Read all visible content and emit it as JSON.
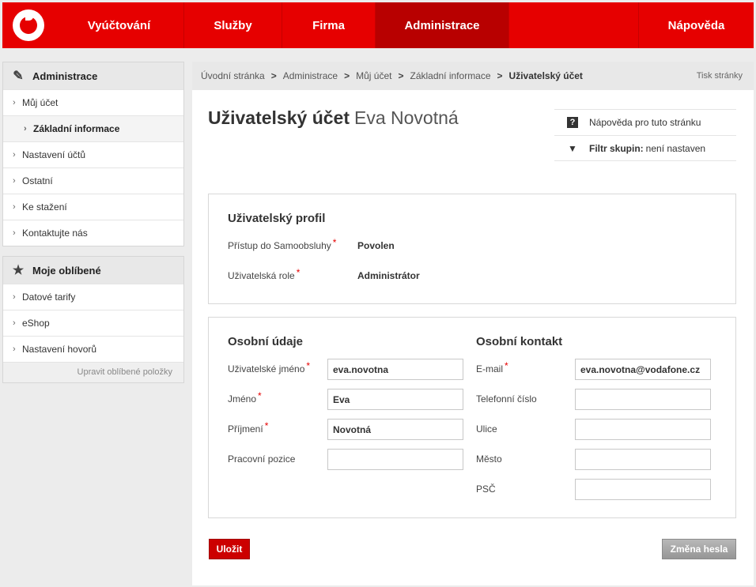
{
  "nav": {
    "items": [
      "Vyúčtování",
      "Služby",
      "Firma",
      "Administrace"
    ],
    "help": "Nápověda"
  },
  "sidebar": {
    "admin": {
      "title": "Administrace",
      "items": [
        "Můj účet",
        "Základní informace",
        "Nastavení účtů",
        "Ostatní",
        "Ke stažení",
        "Kontaktujte nás"
      ]
    },
    "favorites": {
      "title": "Moje oblíbené",
      "items": [
        "Datové tarify",
        "eShop",
        "Nastavení hovorů"
      ],
      "edit": "Upravit oblíbené položky"
    }
  },
  "breadcrumb": {
    "items": [
      "Úvodní stránka",
      "Administrace",
      "Můj účet",
      "Základní informace"
    ],
    "current": "Uživatelský účet",
    "print": "Tisk stránky"
  },
  "page": {
    "title": "Uživatelský účet",
    "name": "Eva Novotná"
  },
  "help_box": {
    "help": "Nápověda pro tuto stránku",
    "filter_label": "Filtr skupin:",
    "filter_value": "není nastaven"
  },
  "profile": {
    "title": "Uživatelský profil",
    "access_label": "Přístup do Samoobsluhy",
    "access_value": "Povolen",
    "role_label": "Uživatelská role",
    "role_value": "Administrátor"
  },
  "personal": {
    "title": "Osobní údaje",
    "username_label": "Uživatelské jméno",
    "username": "eva.novotna",
    "firstname_label": "Jméno",
    "firstname": "Eva",
    "lastname_label": "Příjmení",
    "lastname": "Novotná",
    "position_label": "Pracovní pozice",
    "position": ""
  },
  "contact": {
    "title": "Osobní kontakt",
    "email_label": "E-mail",
    "email": "eva.novotna@vodafone.cz",
    "phone_label": "Telefonní číslo",
    "phone": "",
    "street_label": "Ulice",
    "street": "",
    "city_label": "Město",
    "city": "",
    "zip_label": "PSČ",
    "zip": ""
  },
  "buttons": {
    "save": "Uložit",
    "change_password": "Změna hesla"
  },
  "colors": {
    "brand": "#e60000",
    "nav_active": "#b80000"
  }
}
